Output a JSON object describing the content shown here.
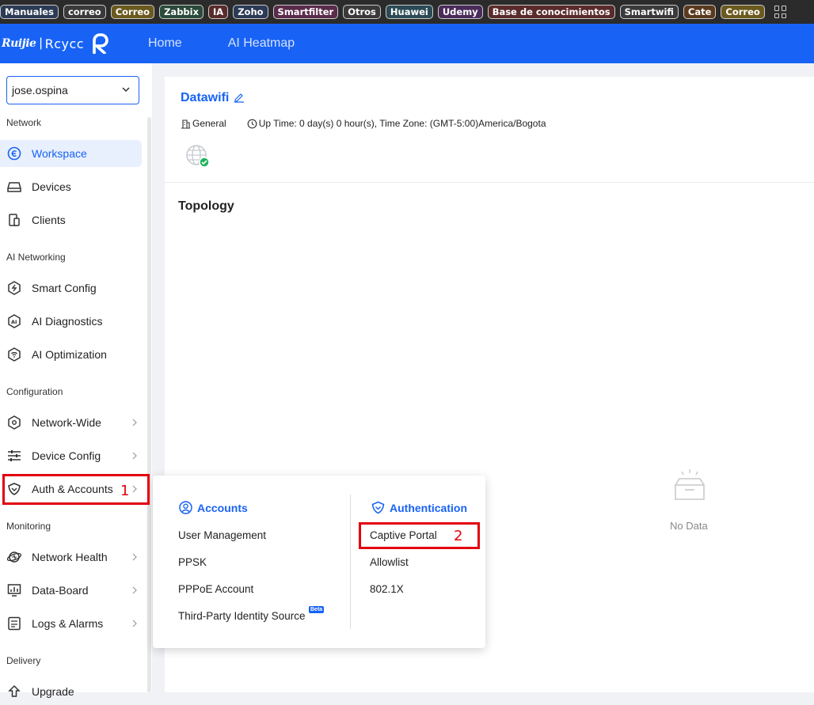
{
  "bookmarks": [
    {
      "label": "Manuales",
      "bg": "#2b3a55"
    },
    {
      "label": "correo",
      "bg": "#3a3a3a"
    },
    {
      "label": "Correo",
      "bg": "#6b5a1e"
    },
    {
      "label": "Zabbix",
      "bg": "#2b4a3a"
    },
    {
      "label": "IA",
      "bg": "#5a2b2b"
    },
    {
      "label": "Zoho",
      "bg": "#2b3a55"
    },
    {
      "label": "Smartfilter",
      "bg": "#5a2b4a"
    },
    {
      "label": "Otros",
      "bg": "#3a3a3a"
    },
    {
      "label": "Huawei",
      "bg": "#2b4a55"
    },
    {
      "label": "Udemy",
      "bg": "#4a2b5a"
    },
    {
      "label": "Base de conocimientos",
      "bg": "#5a2b2b"
    },
    {
      "label": "Smartwifi",
      "bg": "#3a3a3a"
    },
    {
      "label": "Cate",
      "bg": "#5a3a1e"
    },
    {
      "label": "Correo",
      "bg": "#6b5a1e"
    }
  ],
  "brand": {
    "ruijie": "Ruijie",
    "sep": "|",
    "reyee": "Rcycc"
  },
  "nav": {
    "home": "Home",
    "heatmap": "AI Heatmap"
  },
  "account_select": {
    "value": "jose.ospina"
  },
  "sidebar": {
    "sections": {
      "network": "Network",
      "ai_networking": "AI Networking",
      "configuration": "Configuration",
      "monitoring": "Monitoring",
      "delivery": "Delivery"
    },
    "items": {
      "workspace": "Workspace",
      "devices": "Devices",
      "clients": "Clients",
      "smart_config": "Smart Config",
      "ai_diagnostics": "AI Diagnostics",
      "ai_optimization": "AI Optimization",
      "network_wide": "Network-Wide",
      "device_config": "Device Config",
      "auth_accounts": "Auth & Accounts",
      "network_health": "Network Health",
      "data_board": "Data-Board",
      "logs_alarms": "Logs & Alarms",
      "upgrade": "Upgrade"
    }
  },
  "site": {
    "name": "Datawifi",
    "scene": "General",
    "uptime": "Up Time: 0 day(s) 0 hour(s), Time Zone: (GMT-5:00)America/Bogota"
  },
  "topology": {
    "title": "Topology",
    "empty": "No Data"
  },
  "flyout": {
    "accounts": {
      "title": "Accounts",
      "items": [
        "User Management",
        "PPSK",
        "PPPoE Account",
        "Third-Party Identity Source"
      ],
      "beta": "Beta"
    },
    "authentication": {
      "title": "Authentication",
      "items": [
        "Captive Portal",
        "Allowlist",
        "802.1X"
      ]
    }
  },
  "annotations": {
    "step1": "1",
    "step2": "2"
  },
  "colors": {
    "accent": "#1863f5",
    "annotation": "#e3000f",
    "online": "#1fb35a"
  }
}
